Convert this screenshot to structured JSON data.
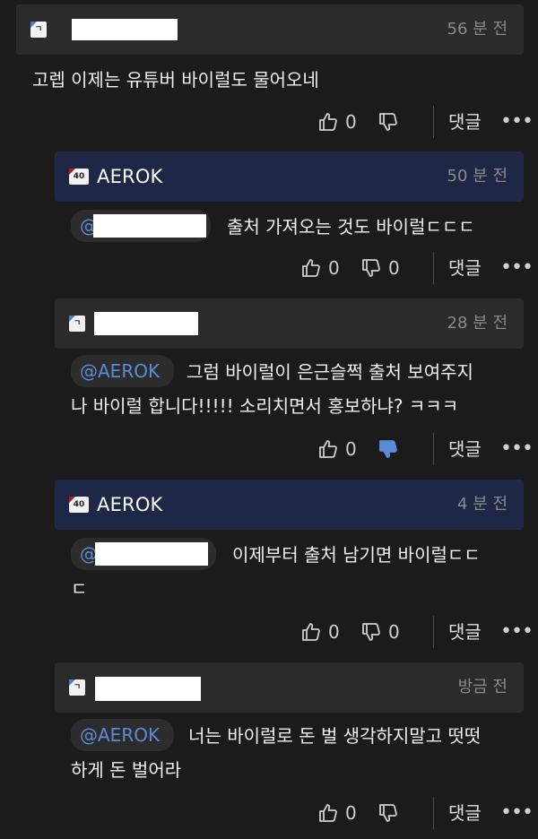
{
  "labels": {
    "reply": "댓글",
    "more": "•••"
  },
  "colors": {
    "accent": "#5b8bd6",
    "author_header": "#1f2747",
    "header": "#2b2b2b",
    "background": "#1b1b1b"
  },
  "comments": [
    {
      "nickname": "",
      "level": "ㄱ",
      "time": "56 분 전",
      "text": "고렙 이제는 유튜버 바이럴도 물어오네",
      "likes": "0",
      "dislikes": "",
      "disliked": false
    },
    {
      "nickname": "AEROK",
      "level": "40",
      "time": "50 분 전",
      "mention": "@",
      "text": "출처 가져오는 것도 바이럴ㄷㄷㄷ",
      "likes": "0",
      "dislikes": "0",
      "disliked": false
    },
    {
      "nickname": "",
      "level": "ㄱ",
      "time": "28 분 전",
      "mention": "@AEROK",
      "text_line1": "그럼 바이럴이 은근슬쩍 출처 보여주지",
      "text_line2": "나 바이럴 합니다!!!!! 소리치면서 홍보하냐? ㅋㅋㅋ",
      "likes": "0",
      "dislikes": "",
      "disliked": true
    },
    {
      "nickname": "AEROK",
      "level": "40",
      "time": "4 분 전",
      "mention": "@",
      "text_line1": "이제부터 출처 남기면 바이럴ㄷㄷ",
      "text_line2": "ㄷ",
      "likes": "0",
      "dislikes": "0",
      "disliked": false
    },
    {
      "nickname": "",
      "level": "ㄱ",
      "time": "방금 전",
      "mention": "@AEROK",
      "text_line1": "너는 바이럴로 돈 벌 생각하지말고 떳떳",
      "text_line2": "하게 돈 벌어라",
      "likes": "0",
      "dislikes": "",
      "disliked": false
    }
  ]
}
